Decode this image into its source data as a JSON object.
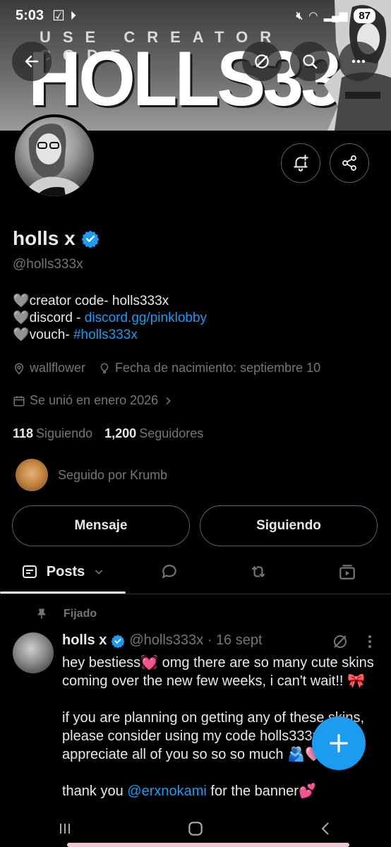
{
  "status_bar": {
    "time": "5:03",
    "battery": "87"
  },
  "banner": {
    "line1": "USE CREATOR CODE",
    "line2": "HOLLS333X"
  },
  "profile": {
    "name": "holls x",
    "handle": "@holls333x",
    "bio": [
      {
        "prefix": "🩶creator code- holls333x",
        "link": ""
      },
      {
        "prefix": "🩶discord - ",
        "link": "discord.gg/pinklobby"
      },
      {
        "prefix": "🩶vouch- ",
        "link": "#holls333x"
      }
    ],
    "location": "wallflower",
    "birthday": "Fecha de nacimiento: septiembre 10",
    "joined": "Se unió en enero 2026",
    "following_count": "118",
    "following_label": "Siguiendo",
    "followers_count": "1,200",
    "followers_label": "Seguidores",
    "followed_by": "Seguido por Krumb"
  },
  "actions": {
    "message": "Mensaje",
    "following": "Siguiendo"
  },
  "tabs": {
    "posts": "Posts"
  },
  "tweet": {
    "pinned_label": "Fijado",
    "name": "holls x",
    "handle_time": "@holls333x · 16 sept",
    "para1": "hey bestiess💓 omg there are so many cute skins coming over the new few weeks, i can't wait!! 🎀",
    "para2": "if you are planning on getting any of these skins, please consider using my code holls333x 🌸 i appreciate all of you so so so much 🫂🩷",
    "para3_prefix": "thank you ",
    "para3_link": "@erxnokami",
    "para3_suffix": " for the banner💕"
  },
  "colors": {
    "accent": "#1d9bf0",
    "background": "#000000",
    "secondary_text": "#71767b"
  }
}
